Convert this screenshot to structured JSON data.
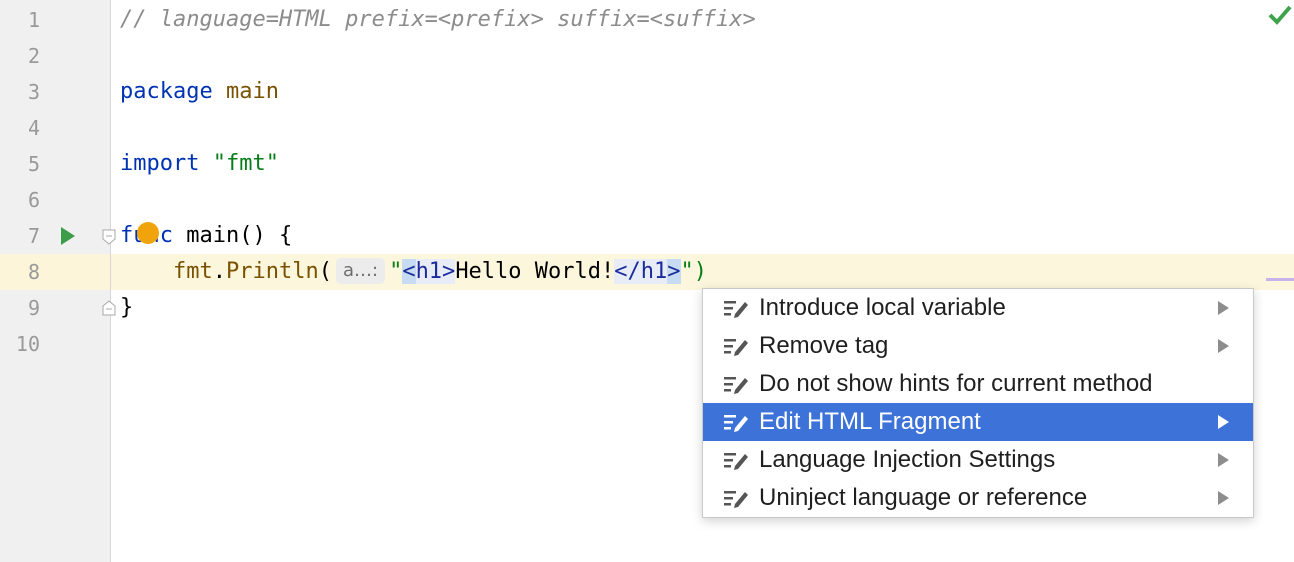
{
  "editor": {
    "line_numbers": [
      "1",
      "2",
      "3",
      "4",
      "5",
      "6",
      "7",
      "8",
      "9",
      "10"
    ],
    "line1_comment": "// language=HTML prefix=<prefix> suffix=<suffix>",
    "line3_keyword": "package",
    "line3_name": "main",
    "line5_keyword": "import",
    "line5_string": "\"fmt\"",
    "line7_keyword": "func",
    "line7_rest": "main() {",
    "line8_indent": "    ",
    "line8_pkg": "fmt",
    "line8_dot": ".",
    "line8_fn": "Println",
    "line8_open": "(",
    "line8_hint": "a…:",
    "line8_quote_open": "\"",
    "line8_tag_open": "<h1>",
    "line8_text": "Hello World!",
    "line8_tag_close_start": "</h1",
    "line8_tag_close_end": ">",
    "line8_quote_close": "\")",
    "line9": "}"
  },
  "context_menu": {
    "items": [
      {
        "label": "Introduce local variable",
        "submenu": true
      },
      {
        "label": "Remove tag",
        "submenu": true
      },
      {
        "label": "Do not show hints for current method",
        "submenu": false
      },
      {
        "label": "Edit HTML Fragment",
        "submenu": true,
        "selected": true
      },
      {
        "label": "Language Injection Settings",
        "submenu": true
      },
      {
        "label": "Uninject language or reference",
        "submenu": true
      }
    ]
  },
  "colors": {
    "selection": "#3d73d9",
    "keyword": "#0033b3",
    "string": "#067d17",
    "current_line": "#fcf7dc",
    "check": "#3fa34d"
  },
  "icons": [
    "check-icon",
    "run-icon",
    "fold-icon",
    "intention-bulb-icon",
    "intention-action-icon",
    "submenu-arrow-icon"
  ]
}
